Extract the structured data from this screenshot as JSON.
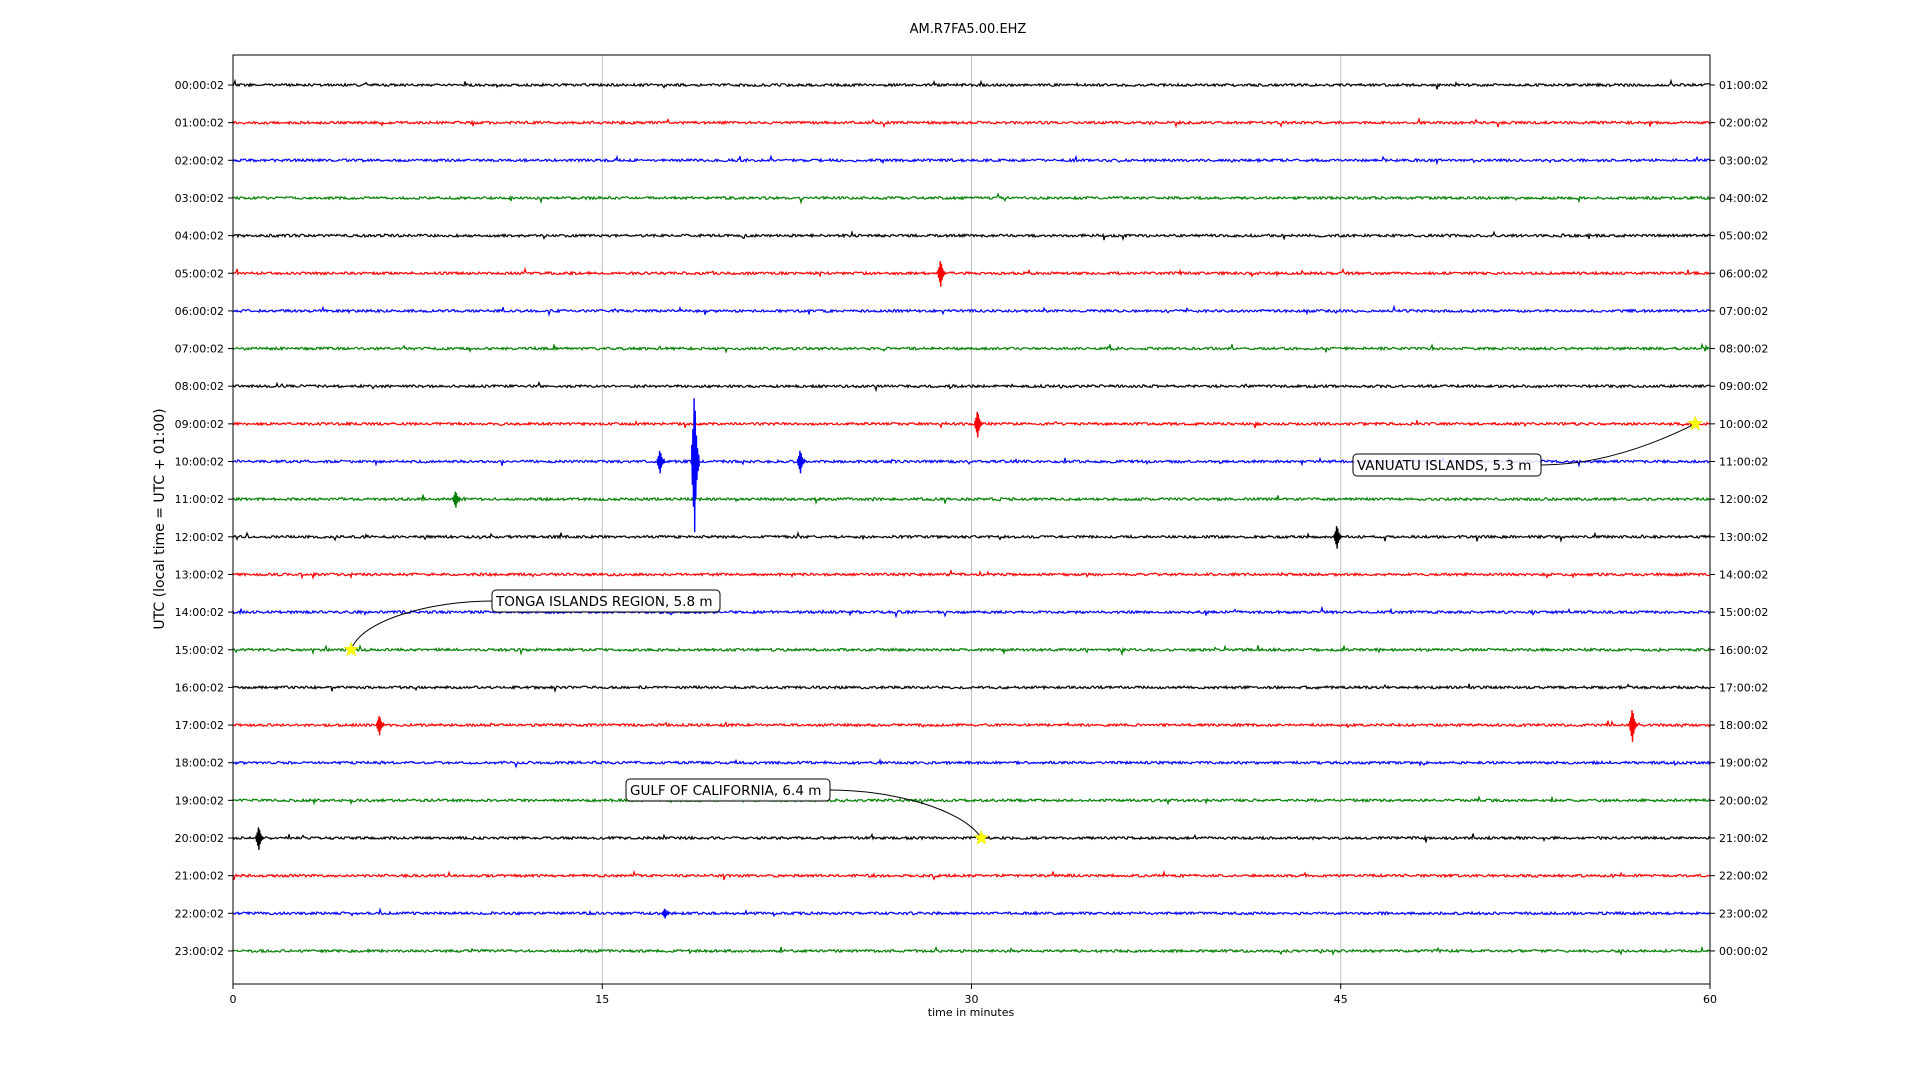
{
  "chart_data": {
    "type": "line",
    "title": "AM.R7FA5.00.EHZ",
    "xlabel": "time in minutes",
    "ylabel": "UTC (local time = UTC + 01:00)",
    "xlim": [
      0,
      60
    ],
    "xticks": [
      0,
      15,
      30,
      45,
      60
    ],
    "vertical_grid": true,
    "colors": [
      "#000000",
      "#ff0000",
      "#0000ff",
      "#008000"
    ],
    "rows": [
      {
        "left_label": "00:00:02",
        "right_label": "01:00:02"
      },
      {
        "left_label": "01:00:02",
        "right_label": "02:00:02"
      },
      {
        "left_label": "02:00:02",
        "right_label": "03:00:02"
      },
      {
        "left_label": "03:00:02",
        "right_label": "04:00:02"
      },
      {
        "left_label": "04:00:02",
        "right_label": "05:00:02"
      },
      {
        "left_label": "05:00:02",
        "right_label": "06:00:02"
      },
      {
        "left_label": "06:00:02",
        "right_label": "07:00:02"
      },
      {
        "left_label": "07:00:02",
        "right_label": "08:00:02"
      },
      {
        "left_label": "08:00:02",
        "right_label": "09:00:02"
      },
      {
        "left_label": "09:00:02",
        "right_label": "10:00:02"
      },
      {
        "left_label": "10:00:02",
        "right_label": "11:00:02"
      },
      {
        "left_label": "11:00:02",
        "right_label": "12:00:02"
      },
      {
        "left_label": "12:00:02",
        "right_label": "13:00:02"
      },
      {
        "left_label": "13:00:02",
        "right_label": "14:00:02"
      },
      {
        "left_label": "14:00:02",
        "right_label": "15:00:02"
      },
      {
        "left_label": "15:00:02",
        "right_label": "16:00:02"
      },
      {
        "left_label": "16:00:02",
        "right_label": "17:00:02"
      },
      {
        "left_label": "17:00:02",
        "right_label": "18:00:02"
      },
      {
        "left_label": "18:00:02",
        "right_label": "19:00:02"
      },
      {
        "left_label": "19:00:02",
        "right_label": "20:00:02"
      },
      {
        "left_label": "20:00:02",
        "right_label": "21:00:02"
      },
      {
        "left_label": "21:00:02",
        "right_label": "22:00:02"
      },
      {
        "left_label": "22:00:02",
        "right_label": "23:00:02"
      },
      {
        "left_label": "23:00:02",
        "right_label": "00:00:02"
      }
    ],
    "events": [
      {
        "label": "VANUATU ISLANDS, 5.3 m",
        "row": 9,
        "minute": 59.4
      },
      {
        "label": "TONGA ISLANDS REGION, 5.8 m",
        "row": 15,
        "minute": 4.8
      },
      {
        "label": "GULF OF CALIFORNIA, 6.4 m",
        "row": 20,
        "minute": 30.4
      }
    ],
    "spikes": [
      {
        "row": 5,
        "minute": 28.8,
        "amplitude": 0.4
      },
      {
        "row": 9,
        "minute": 30.3,
        "amplitude": 0.4
      },
      {
        "row": 10,
        "minute": 18.8,
        "amplitude": 2.1
      },
      {
        "row": 10,
        "minute": 17.4,
        "amplitude": 0.35
      },
      {
        "row": 10,
        "minute": 23.1,
        "amplitude": 0.35
      },
      {
        "row": 11,
        "minute": 9.1,
        "amplitude": 0.25
      },
      {
        "row": 12,
        "minute": 44.9,
        "amplitude": 0.35
      },
      {
        "row": 17,
        "minute": 6.0,
        "amplitude": 0.3
      },
      {
        "row": 17,
        "minute": 56.9,
        "amplitude": 0.5
      },
      {
        "row": 20,
        "minute": 1.1,
        "amplitude": 0.35
      },
      {
        "row": 22,
        "minute": 17.6,
        "amplitude": 0.15
      }
    ]
  }
}
